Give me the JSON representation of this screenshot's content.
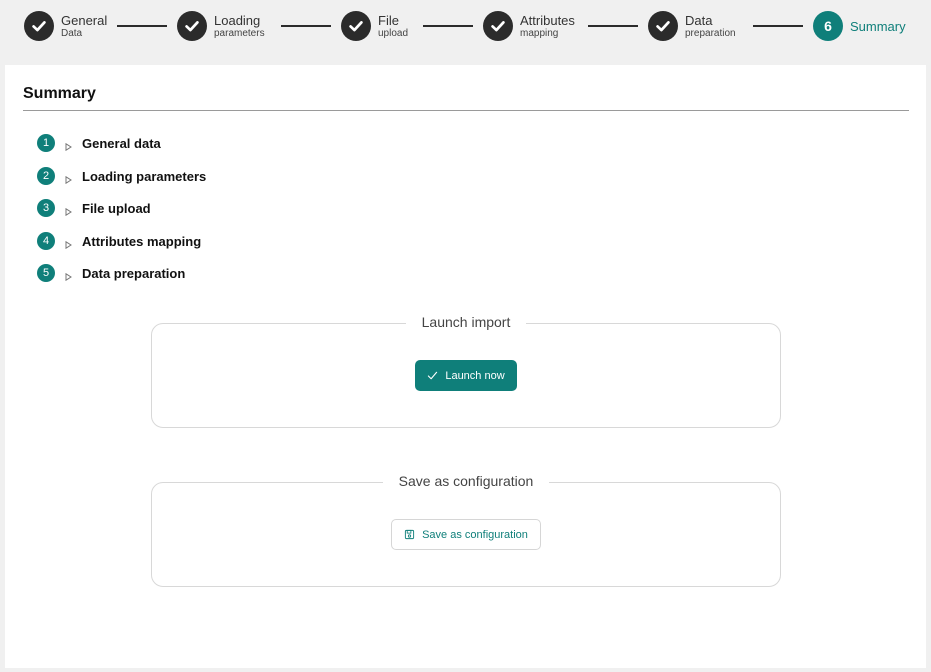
{
  "stepper": {
    "steps": [
      {
        "title": "General",
        "sub": "Data",
        "state": "done"
      },
      {
        "title": "Loading",
        "sub": "parameters",
        "state": "done"
      },
      {
        "title": "File",
        "sub": "upload",
        "state": "done"
      },
      {
        "title": "Attributes",
        "sub": "mapping",
        "state": "done"
      },
      {
        "title": "Data",
        "sub": "preparation",
        "state": "done"
      },
      {
        "number": "6",
        "title": "Summary",
        "state": "active"
      }
    ]
  },
  "panel": {
    "title": "Summary",
    "items": [
      {
        "number": "1",
        "label": "General data"
      },
      {
        "number": "2",
        "label": "Loading parameters"
      },
      {
        "number": "3",
        "label": "File upload"
      },
      {
        "number": "4",
        "label": "Attributes mapping"
      },
      {
        "number": "5",
        "label": "Data preparation"
      }
    ],
    "launch": {
      "legend": "Launch import",
      "button": "Launch now"
    },
    "save": {
      "legend": "Save as configuration",
      "button": "Save as configuration"
    }
  },
  "colors": {
    "accent": "#0f7f7a",
    "done": "#2b2b2b"
  }
}
